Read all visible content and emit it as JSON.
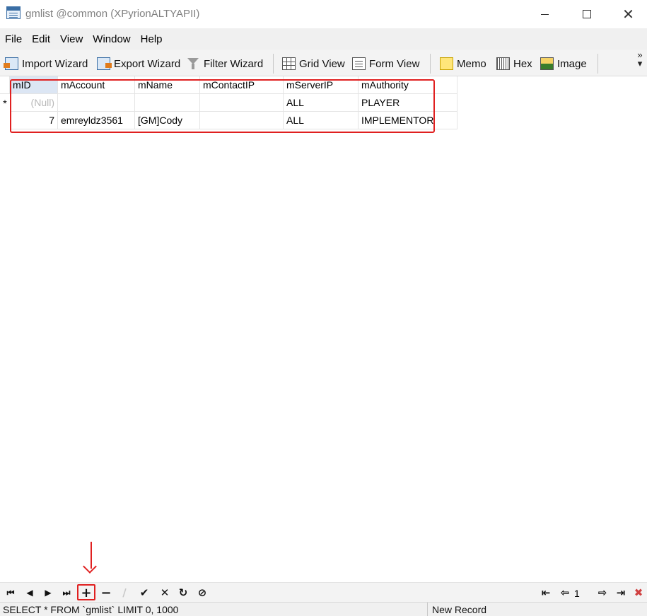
{
  "window": {
    "title": "gmlist @common (XPyrionALTYAPII)",
    "minimize_icon": "minimize-icon",
    "maximize_icon": "maximize-icon",
    "close_symbol": "✕"
  },
  "menu": [
    "File",
    "Edit",
    "View",
    "Window",
    "Help"
  ],
  "toolbar": {
    "import_wizard": "Import Wizard",
    "export_wizard": "Export Wizard",
    "filter_wizard": "Filter Wizard",
    "grid_view": "Grid View",
    "form_view": "Form View",
    "memo": "Memo",
    "hex": "Hex",
    "image": "Image",
    "overflow": "»"
  },
  "grid": {
    "columns": [
      "mID",
      "mAccount",
      "mName",
      "mContactIP",
      "mServerIP",
      "mAuthority"
    ],
    "new_row_indicator": "*",
    "rows": [
      {
        "mID": "(Null)",
        "mAccount": "",
        "mName": "",
        "mContactIP": "",
        "mServerIP": "ALL",
        "mAuthority": "PLAYER"
      },
      {
        "mID": "7",
        "mAccount": "emreyldz3561",
        "mName": "[GM]Cody",
        "mContactIP": "",
        "mServerIP": "ALL",
        "mAuthority": "IMPLEMENTOR"
      }
    ]
  },
  "navigator": {
    "first": "⏮",
    "prev": "◀",
    "next": "▶",
    "last": "⏭",
    "add": "+",
    "delete": "−",
    "edit": "∕",
    "post": "✔",
    "cancel": "✕",
    "refresh": "↻",
    "stop": "⊘",
    "page_first": "⇤",
    "page_prev": "⇦",
    "page_number": "1",
    "page_next": "⇨",
    "page_last": "⇥",
    "tools": "✖"
  },
  "status": {
    "sql": "SELECT * FROM `gmlist` LIMIT 0, 1000",
    "mode": "New Record"
  },
  "colors": {
    "annotation": "#e02020",
    "null_text": "#b8b8b8",
    "header_selected": "#dce6f4"
  }
}
